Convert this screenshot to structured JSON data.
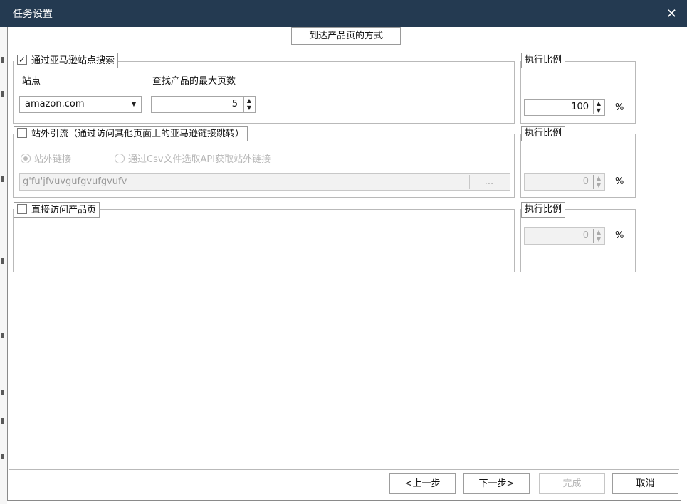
{
  "window": {
    "title": "任务设置",
    "close": "✕"
  },
  "main": {
    "section_title": "到达产品页的方式"
  },
  "search": {
    "legend": "通过亚马逊站点搜索",
    "site_label": "站点",
    "site_value": "amazon.com",
    "pages_label": "查找产品的最大页数",
    "pages_value": "5"
  },
  "external": {
    "legend": "站外引流（通过访问其他页面上的亚马逊链接跳转）",
    "option1": "站外链接",
    "option2": "通过Csv文件选取API获取站外链接",
    "url_value": "g'fu'jfvuvgufgvufgvufv",
    "browse": "..."
  },
  "direct": {
    "legend": "直接访问产品页"
  },
  "ratio": {
    "label": "执行比例",
    "search": "100",
    "external": "0",
    "direct": "0",
    "percent": "%"
  },
  "buttons": {
    "prev": "<上一步",
    "next": "下一步>",
    "finish": "完成",
    "cancel": "取消"
  }
}
